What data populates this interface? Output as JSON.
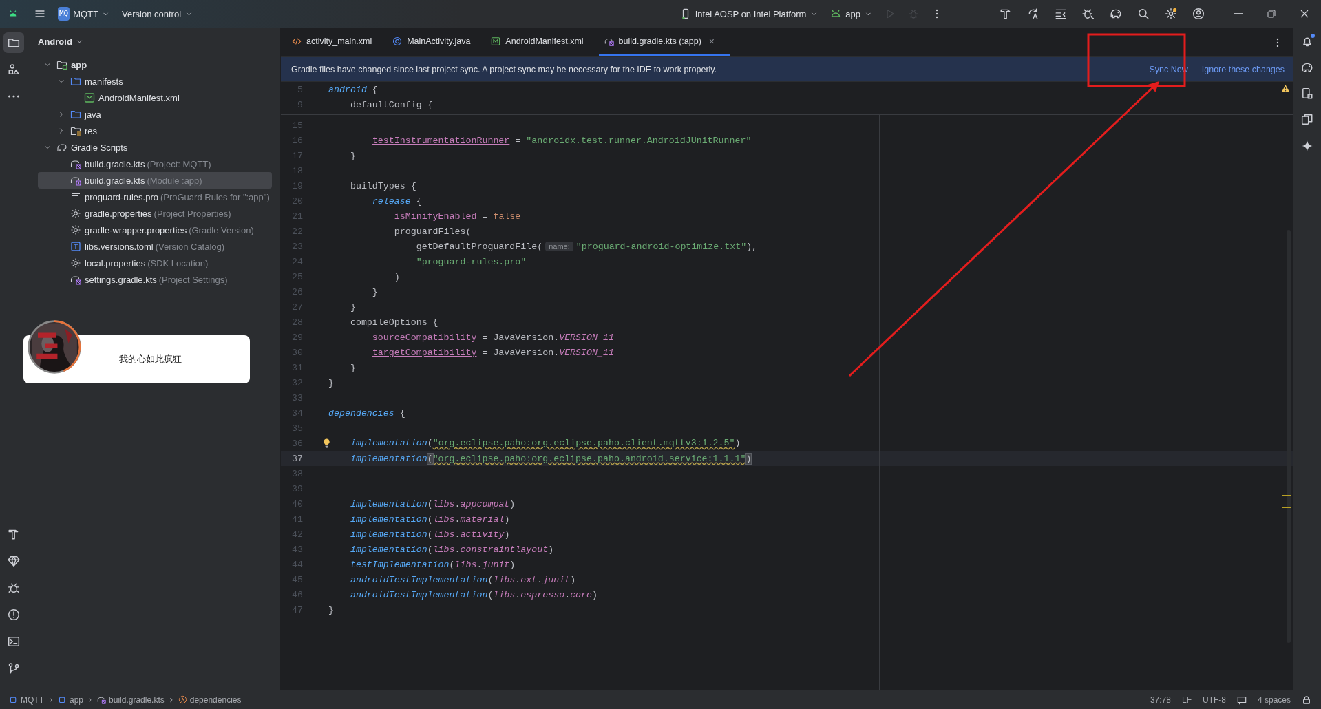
{
  "title_bar": {
    "project": {
      "badge": "MQ",
      "name": "MQTT"
    },
    "vcs": "Version control",
    "device": "Intel AOSP on Intel Platform",
    "run_config": "app",
    "run_disabled": true
  },
  "left_tools": [
    {
      "kind": "folder",
      "selected": true
    },
    {
      "kind": "structure",
      "selected": false
    },
    {
      "kind": "more",
      "selected": false
    },
    {
      "kind": "hammer",
      "selected": false
    },
    {
      "kind": "gem",
      "selected": false
    },
    {
      "kind": "bug",
      "selected": false
    },
    {
      "kind": "problems",
      "selected": false
    },
    {
      "kind": "terminal",
      "selected": false
    },
    {
      "kind": "git",
      "selected": false
    }
  ],
  "project_panel": {
    "view": "Android",
    "tree": [
      {
        "name": "app",
        "kind": "module",
        "expanded": true,
        "selected": false,
        "children": [
          {
            "name": "manifests",
            "kind": "folder",
            "expanded": true,
            "selected": false,
            "children": [
              {
                "name": "AndroidManifest.xml",
                "kind": "manifest",
                "selected": false
              }
            ]
          },
          {
            "name": "java",
            "kind": "folder",
            "expanded": false,
            "selected": false
          },
          {
            "name": "res",
            "kind": "res",
            "expanded": false,
            "selected": false
          }
        ]
      },
      {
        "name": "Gradle Scripts",
        "kind": "gradle",
        "expanded": true,
        "selected": false,
        "children": [
          {
            "name": "build.gradle.kts",
            "note": "(Project: MQTT)",
            "kind": "gradlekts",
            "selected": false
          },
          {
            "name": "build.gradle.kts",
            "note": "(Module :app)",
            "kind": "gradlekts",
            "selected": true
          },
          {
            "name": "proguard-rules.pro",
            "note": "(ProGuard Rules for \":app\")",
            "kind": "lines",
            "selected": false
          },
          {
            "name": "gradle.properties",
            "note": "(Project Properties)",
            "kind": "gear",
            "selected": false
          },
          {
            "name": "gradle-wrapper.properties",
            "note": "(Gradle Version)",
            "kind": "gear",
            "selected": false
          },
          {
            "name": "libs.versions.toml",
            "note": "(Version Catalog)",
            "kind": "toml",
            "selected": false
          },
          {
            "name": "local.properties",
            "note": "(SDK Location)",
            "kind": "gear",
            "selected": false
          },
          {
            "name": "settings.gradle.kts",
            "note": "(Project Settings)",
            "kind": "gradlekts",
            "selected": false
          }
        ]
      }
    ]
  },
  "tabs": [
    {
      "label": "activity_main.xml",
      "kind": "xml",
      "selected": false
    },
    {
      "label": "MainActivity.java",
      "kind": "class",
      "selected": false
    },
    {
      "label": "AndroidManifest.xml",
      "kind": "manifest",
      "selected": false
    },
    {
      "label": "build.gradle.kts (:app)",
      "kind": "gradle",
      "selected": true,
      "close": "×"
    }
  ],
  "banner": {
    "message": "Gradle files have changed since last project sync. A project sync may be necessary for the IDE to work properly.",
    "actions": [
      "Sync Now",
      "Ignore these changes"
    ]
  },
  "editor": {
    "sticky_lines": [
      {
        "number": "5",
        "tokens": [
          {
            "text": "android",
            "kind": "kw"
          },
          {
            "text": " {",
            "kind": "plain"
          }
        ]
      },
      {
        "number": "9",
        "tokens": [
          {
            "text": "    defaultConfig {",
            "kind": "plain"
          }
        ]
      }
    ],
    "lines": [
      {
        "number": "15",
        "current": false
      },
      {
        "number": "16",
        "current": false,
        "tokens": [
          {
            "text": "        testInstrumentationRunner",
            "kind": "prop"
          },
          {
            "text": " = ",
            "kind": "plain"
          },
          {
            "text": "\"androidx.test.runner.AndroidJUnitRunner\"",
            "kind": "str"
          }
        ]
      },
      {
        "number": "17",
        "current": false,
        "tokens": [
          {
            "text": "    }",
            "kind": "plain"
          }
        ]
      },
      {
        "number": "18",
        "current": false
      },
      {
        "number": "19",
        "current": false,
        "tokens": [
          {
            "text": "    buildTypes {",
            "kind": "plain"
          }
        ]
      },
      {
        "number": "20",
        "current": false,
        "tokens": [
          {
            "text": "        release",
            "kind": "kw"
          },
          {
            "text": " {",
            "kind": "plain"
          }
        ]
      },
      {
        "number": "21",
        "current": false,
        "tokens": [
          {
            "text": "            isMinifyEnabled",
            "kind": "prop"
          },
          {
            "text": " = ",
            "kind": "plain"
          },
          {
            "text": "false",
            "kind": "bool"
          }
        ]
      },
      {
        "number": "22",
        "current": false,
        "tokens": [
          {
            "text": "            proguardFiles(",
            "kind": "plain"
          }
        ]
      },
      {
        "number": "23",
        "current": false,
        "tokens": [
          {
            "text": "                getDefaultProguardFile(",
            "kind": "plain"
          },
          {
            "text": "name:",
            "kind": "hint"
          },
          {
            "text": "\"proguard-android-optimize.txt\"",
            "kind": "str"
          },
          {
            "text": "),",
            "kind": "plain"
          }
        ]
      },
      {
        "number": "24",
        "current": false,
        "tokens": [
          {
            "text": "                \"proguard-rules.pro\"",
            "kind": "str"
          }
        ]
      },
      {
        "number": "25",
        "current": false,
        "tokens": [
          {
            "text": "            )",
            "kind": "plain"
          }
        ]
      },
      {
        "number": "26",
        "current": false,
        "tokens": [
          {
            "text": "        }",
            "kind": "plain"
          }
        ]
      },
      {
        "number": "27",
        "current": false,
        "tokens": [
          {
            "text": "    }",
            "kind": "plain"
          }
        ]
      },
      {
        "number": "28",
        "current": false,
        "tokens": [
          {
            "text": "    compileOptions {",
            "kind": "plain"
          }
        ]
      },
      {
        "number": "29",
        "current": false,
        "tokens": [
          {
            "text": "        sourceCompatibility",
            "kind": "prop"
          },
          {
            "text": " = JavaVersion.",
            "kind": "plain"
          },
          {
            "text": "VERSION_11",
            "kind": "const"
          }
        ]
      },
      {
        "number": "30",
        "current": false,
        "tokens": [
          {
            "text": "        targetCompatibility",
            "kind": "prop"
          },
          {
            "text": " = JavaVersion.",
            "kind": "plain"
          },
          {
            "text": "VERSION_11",
            "kind": "const"
          }
        ]
      },
      {
        "number": "31",
        "current": false,
        "tokens": [
          {
            "text": "    }",
            "kind": "plain"
          }
        ]
      },
      {
        "number": "32",
        "current": false,
        "tokens": [
          {
            "text": "}",
            "kind": "plain"
          }
        ]
      },
      {
        "number": "33",
        "current": false
      },
      {
        "number": "34",
        "current": false,
        "tokens": [
          {
            "text": "dependencies",
            "kind": "kw"
          },
          {
            "text": " {",
            "kind": "plain"
          }
        ]
      },
      {
        "number": "35",
        "current": false
      },
      {
        "number": "36",
        "current": false,
        "tokens": [
          {
            "kind": "bulb"
          },
          {
            "text": "  implementation",
            "kind": "kw"
          },
          {
            "text": "(",
            "kind": "plain"
          },
          {
            "text": "\"org.eclipse.paho:org.eclipse.paho.client.mqttv3:1.2.5\"",
            "kind": "strwarn"
          },
          {
            "text": ")",
            "kind": "plain"
          }
        ]
      },
      {
        "number": "37",
        "current": true,
        "tokens": [
          {
            "text": "    implementation",
            "kind": "kw"
          },
          {
            "text": "(",
            "kind": "brace"
          },
          {
            "text": "\"org.eclipse.paho:org.eclipse.paho.android.service:1.1.1\"",
            "kind": "strwarn"
          },
          {
            "text": ")",
            "kind": "brace"
          }
        ]
      },
      {
        "number": "38",
        "current": false
      },
      {
        "number": "39",
        "current": false
      },
      {
        "number": "40",
        "current": false,
        "tokens": [
          {
            "text": "    implementation",
            "kind": "kw"
          },
          {
            "text": "(",
            "kind": "plain"
          },
          {
            "text": "libs",
            "kind": "const"
          },
          {
            "text": ".",
            "kind": "plain"
          },
          {
            "text": "appcompat",
            "kind": "const"
          },
          {
            "text": ")",
            "kind": "plain"
          }
        ]
      },
      {
        "number": "41",
        "current": false,
        "tokens": [
          {
            "text": "    implementation",
            "kind": "kw"
          },
          {
            "text": "(",
            "kind": "plain"
          },
          {
            "text": "libs",
            "kind": "const"
          },
          {
            "text": ".",
            "kind": "plain"
          },
          {
            "text": "material",
            "kind": "const"
          },
          {
            "text": ")",
            "kind": "plain"
          }
        ]
      },
      {
        "number": "42",
        "current": false,
        "tokens": [
          {
            "text": "    implementation",
            "kind": "kw"
          },
          {
            "text": "(",
            "kind": "plain"
          },
          {
            "text": "libs",
            "kind": "const"
          },
          {
            "text": ".",
            "kind": "plain"
          },
          {
            "text": "activity",
            "kind": "const"
          },
          {
            "text": ")",
            "kind": "plain"
          }
        ]
      },
      {
        "number": "43",
        "current": false,
        "tokens": [
          {
            "text": "    implementation",
            "kind": "kw"
          },
          {
            "text": "(",
            "kind": "plain"
          },
          {
            "text": "libs",
            "kind": "const"
          },
          {
            "text": ".",
            "kind": "plain"
          },
          {
            "text": "constraintlayout",
            "kind": "const"
          },
          {
            "text": ")",
            "kind": "plain"
          }
        ]
      },
      {
        "number": "44",
        "current": false,
        "tokens": [
          {
            "text": "    testImplementation",
            "kind": "kw"
          },
          {
            "text": "(",
            "kind": "plain"
          },
          {
            "text": "libs",
            "kind": "const"
          },
          {
            "text": ".",
            "kind": "plain"
          },
          {
            "text": "junit",
            "kind": "const"
          },
          {
            "text": ")",
            "kind": "plain"
          }
        ]
      },
      {
        "number": "45",
        "current": false,
        "tokens": [
          {
            "text": "    androidTestImplementation",
            "kind": "kw"
          },
          {
            "text": "(",
            "kind": "plain"
          },
          {
            "text": "libs",
            "kind": "const"
          },
          {
            "text": ".",
            "kind": "plain"
          },
          {
            "text": "ext",
            "kind": "const"
          },
          {
            "text": ".",
            "kind": "plain"
          },
          {
            "text": "junit",
            "kind": "const"
          },
          {
            "text": ")",
            "kind": "plain"
          }
        ]
      },
      {
        "number": "46",
        "current": false,
        "tokens": [
          {
            "text": "    androidTestImplementation",
            "kind": "kw"
          },
          {
            "text": "(",
            "kind": "plain"
          },
          {
            "text": "libs",
            "kind": "const"
          },
          {
            "text": ".",
            "kind": "plain"
          },
          {
            "text": "espresso",
            "kind": "const"
          },
          {
            "text": ".",
            "kind": "plain"
          },
          {
            "text": "core",
            "kind": "const"
          },
          {
            "text": ")",
            "kind": "plain"
          }
        ]
      },
      {
        "number": "47",
        "current": false,
        "tokens": [
          {
            "text": "}",
            "kind": "plain"
          }
        ]
      }
    ]
  },
  "right_tools": [
    {
      "kind": "bell",
      "badge": true
    },
    {
      "kind": "gradle",
      "badge": false
    },
    {
      "kind": "device",
      "badge": false
    },
    {
      "kind": "mirror",
      "badge": false
    },
    {
      "kind": "sparkle",
      "badge": false
    }
  ],
  "status_bar": {
    "breadcrumbs": [
      {
        "label": "MQTT",
        "kind": "module"
      },
      {
        "label": "app",
        "kind": "module"
      },
      {
        "label": "build.gradle.kts",
        "kind": "gradle"
      },
      {
        "label": "dependencies",
        "kind": "lambda"
      }
    ],
    "position": "37:78",
    "line_separator": "LF",
    "encoding": "UTF-8",
    "indent": "4 spaces",
    "read_only": false
  },
  "music_widget": {
    "kind": "picture",
    "song": "我的心如此疯狂"
  },
  "annotations": {
    "highlight_box": true,
    "pointer_arrow": true
  }
}
